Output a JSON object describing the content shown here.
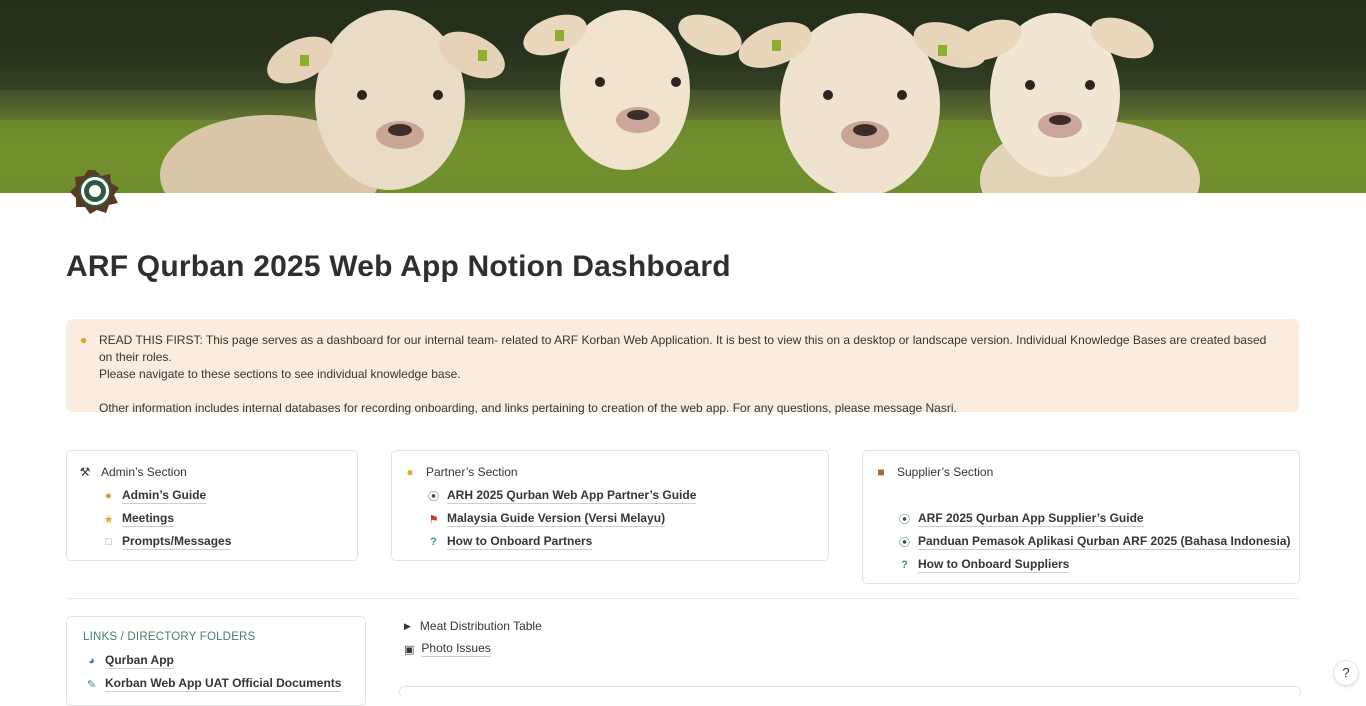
{
  "page": {
    "title": "ARF Qurban 2025 Web App Notion Dashboard"
  },
  "callout": {
    "icon": "lightbulb-icon",
    "line1": "READ THIS FIRST: This page serves as a dashboard for our internal team- related to ARF Korban Web Application. It is best to view this on a desktop or landscape version.  Individual Knowledge Bases are created based on their roles.",
    "line2": "Please navigate to these sections to see individual knowledge base.",
    "line3": "Other information includes internal databases for recording onboarding, and links pertaining to creation of the web app. For any questions, please message Nasri."
  },
  "admin_section": {
    "title": "Admin’s Section",
    "icon": "hammer-wrench-icon",
    "items": [
      {
        "label": "Admin’s Guide",
        "icon": "person-icon"
      },
      {
        "label": "Meetings",
        "icon": "star-icon"
      },
      {
        "label": "Prompts/Messages",
        "icon": "document-icon"
      }
    ]
  },
  "partner_section": {
    "title": "Partner’s Section",
    "icon": "handshake-icon",
    "items": [
      {
        "label": "ARH 2025 Qurban Web App Partner’s Guide",
        "icon": "arf-logo-icon"
      },
      {
        "label": "Malaysia Guide Version (Versi Melayu)",
        "icon": "malaysia-flag-icon"
      },
      {
        "label": "How to Onboard Partners",
        "icon": "question-icon"
      }
    ]
  },
  "supplier_section": {
    "title": "Supplier’s Section",
    "icon": "package-icon",
    "items": [
      {
        "label": "ARF 2025 Qurban App Supplier’s Guide",
        "icon": "arf-logo-icon"
      },
      {
        "label": "Panduan Pemasok Aplikasi Qurban ARF 2025 (Bahasa Indonesia)",
        "icon": "arf-logo-icon"
      },
      {
        "label": "How to Onboard Suppliers",
        "icon": "question-icon"
      }
    ]
  },
  "links": {
    "heading": "LINKS / DIRECTORY FOLDERS",
    "items": [
      {
        "label": "Qurban App",
        "icon": "globe-icon"
      },
      {
        "label": "Korban Web App UAT Official Documents",
        "icon": "pencil-icon"
      }
    ]
  },
  "toggle": {
    "label": "Meat Distribution Table"
  },
  "photo": {
    "label": "Photo Issues",
    "icon": "camera-icon"
  },
  "help": {
    "label": "?"
  },
  "colors": {
    "callout_bg": "#fbece0",
    "links_heading": "#448361",
    "text": "#37352f"
  }
}
